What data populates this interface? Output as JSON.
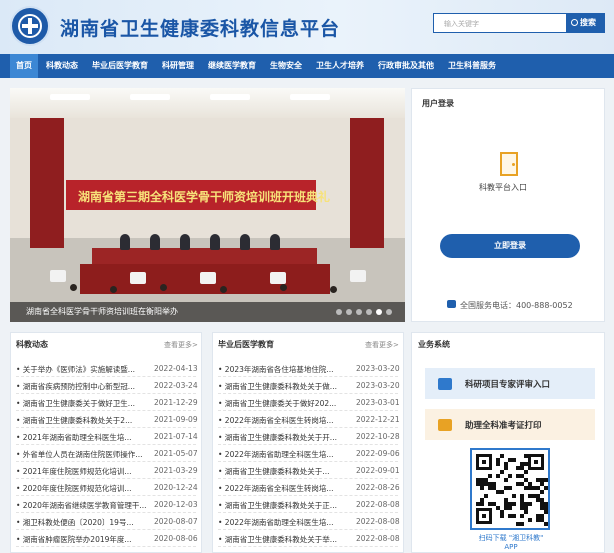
{
  "site": {
    "title": "湖南省卫生健康委科教信息平台"
  },
  "search": {
    "placeholder": "输入关键字",
    "button_label": "搜索"
  },
  "nav": {
    "items": [
      "首页",
      "科教动态",
      "毕业后医学教育",
      "科研管理",
      "继续医学教育",
      "生物安全",
      "卫生人才培养",
      "行政审批及其他",
      "卫生科普服务"
    ],
    "active_index": 0
  },
  "slider": {
    "banner_text": "湖南省第三期全科医学骨干师资培训班开班典礼",
    "caption": "湖南省全科医学骨干师资培训班在衡阳举办",
    "dot_count": 6,
    "active_dot": 4
  },
  "login": {
    "title": "用户登录",
    "portal_label": "科教平台入口",
    "button_label": "立即登录",
    "service_phone": "全国服务电话：400-888-0052"
  },
  "cards": {
    "news": {
      "title": "科教动态",
      "more": "查看更多>",
      "items": [
        {
          "title": "• 关于举办《医师法》实施解读暨...",
          "date": "2022-04-13"
        },
        {
          "title": "• 湖南省疾病预防控制中心新型冠...",
          "date": "2022-03-24"
        },
        {
          "title": "• 湖南省卫生健康委关于做好卫生...",
          "date": "2021-12-29"
        },
        {
          "title": "• 湖南省卫生健康委科教处关于2...",
          "date": "2021-09-09"
        },
        {
          "title": "• 2021年湖南省助理全科医生培...",
          "date": "2021-07-14"
        },
        {
          "title": "• 外省单位人员在湖南住院医师操作...",
          "date": "2021-05-07"
        },
        {
          "title": "• 2021年度住院医师规范化培训...",
          "date": "2021-03-29"
        },
        {
          "title": "• 2020年度住院医师规范化培训...",
          "date": "2020-12-24"
        },
        {
          "title": "• 2020年湖南省继续医学教育管理干...",
          "date": "2020-12-03"
        },
        {
          "title": "• 湘卫科教处便函〔2020〕19号...",
          "date": "2020-08-07"
        },
        {
          "title": "• 湖南省肿瘤医院举办2019年度...",
          "date": "2020-08-06"
        }
      ]
    },
    "grad": {
      "title": "毕业后医学教育",
      "more": "查看更多>",
      "items": [
        {
          "title": "• 2023年湖南省各住培基地住院...",
          "date": "2023-03-20"
        },
        {
          "title": "• 湖南省卫生健康委科教处关于做...",
          "date": "2023-03-20"
        },
        {
          "title": "• 湖南省卫生健康委关于做好202...",
          "date": "2023-03-01"
        },
        {
          "title": "• 2022年湖南省全科医生转岗培...",
          "date": "2022-12-21"
        },
        {
          "title": "• 湖南省卫生健康委科教处关于开...",
          "date": "2022-10-28"
        },
        {
          "title": "• 2022年湖南省助理全科医生培...",
          "date": "2022-09-06"
        },
        {
          "title": "• 湖南省卫生健康委科教处关于...",
          "date": "2022-09-01"
        },
        {
          "title": "• 2022年湖南省全科医生转岗培...",
          "date": "2022-08-26"
        },
        {
          "title": "• 湖南省卫生健康委科教处关于正...",
          "date": "2022-08-08"
        },
        {
          "title": "• 2022年湖南省助理全科医生培...",
          "date": "2022-08-08"
        },
        {
          "title": "• 湖南省卫生健康委科教处关于举...",
          "date": "2022-08-08"
        }
      ]
    }
  },
  "business": {
    "title": "业务系统",
    "items": [
      {
        "label": "科研项目专家评审入口",
        "icon": "login-arrow-icon",
        "color": "#2f79cc"
      },
      {
        "label": "助理全科准考证打印",
        "icon": "printer-icon",
        "color": "#e8a224"
      }
    ],
    "qr_caption": "扫码下载 \"湘卫科教\" APP"
  },
  "colors": {
    "brand": "#1f5fad",
    "active_nav": "#3c87d4",
    "accent_orange": "#e8a224"
  }
}
